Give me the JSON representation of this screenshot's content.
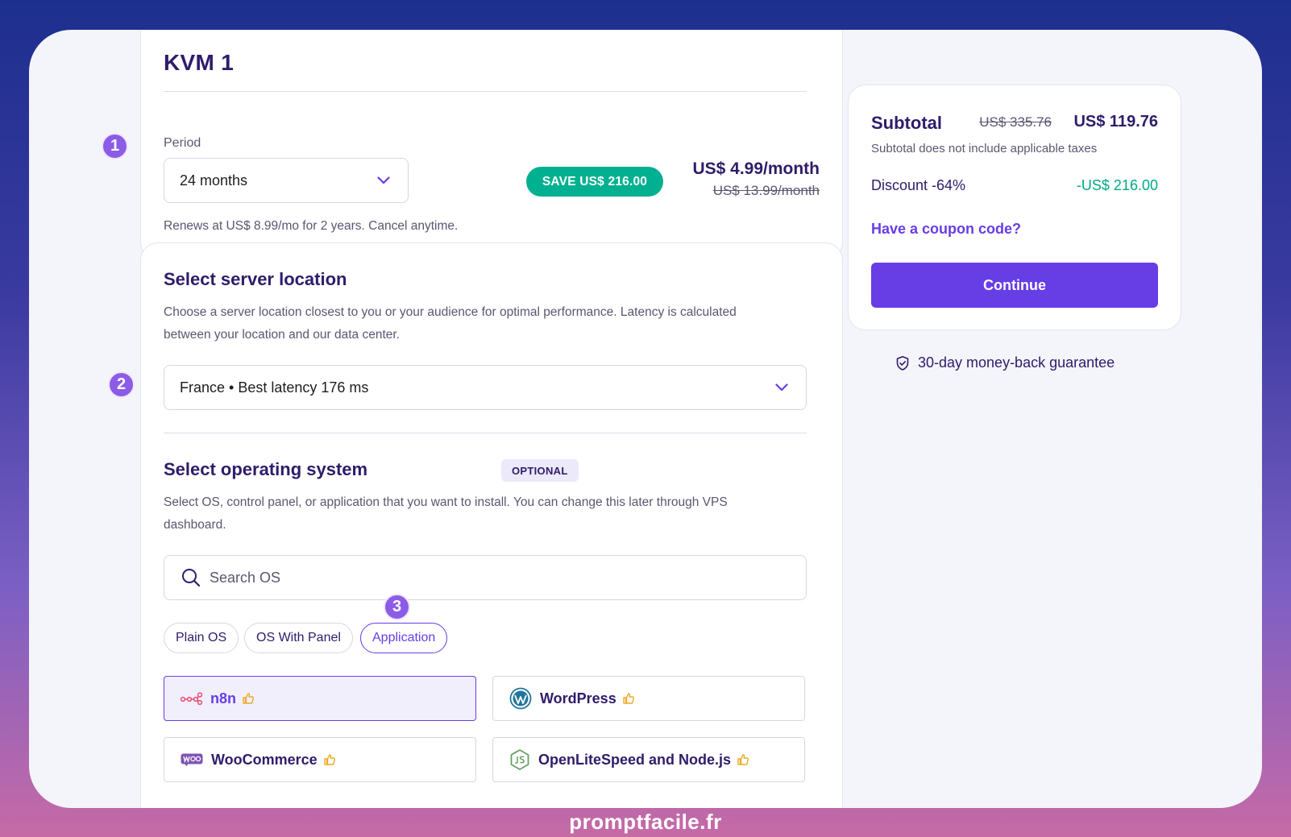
{
  "plan": {
    "title": "KVM 1",
    "period_label": "Period",
    "period_value": "24 months",
    "save_badge": "SAVE US$ 216.00",
    "price_now": "US$ 4.99/month",
    "price_old": "US$ 13.99/month",
    "renew_note": "Renews at US$ 8.99/mo for 2 years. Cancel anytime."
  },
  "steps": [
    "1",
    "2",
    "3"
  ],
  "location": {
    "heading": "Select server location",
    "description_line1": "Choose a server location closest to you or your audience for optimal performance. Latency is calculated",
    "description_line2": "between your location and our data center.",
    "selected": "France • Best latency 176 ms"
  },
  "os": {
    "heading": "Select operating system",
    "optional_badge": "OPTIONAL",
    "description_line1": "Select OS, control panel, or application that you want to install. You can change this later through VPS",
    "description_line2": "dashboard.",
    "search_placeholder": "Search OS",
    "filters": [
      "Plain OS",
      "OS With Panel",
      "Application"
    ],
    "active_filter": "Application",
    "apps": [
      "n8n",
      "WordPress",
      "WooCommerce",
      "OpenLiteSpeed and Node.js"
    ],
    "selected_app": "n8n"
  },
  "summary": {
    "title": "Subtotal",
    "old_price": "US$ 335.76",
    "new_price": "US$ 119.76",
    "note": "Subtotal does not include applicable taxes",
    "discount_label": "Discount -64%",
    "discount_value": "-US$ 216.00",
    "coupon_link": "Have a coupon code?",
    "continue_label": "Continue",
    "guarantee": "30-day money-back guarantee"
  },
  "watermark": "promptfacile.fr",
  "colors": {
    "primary": "#673de6",
    "success": "#00b090",
    "step_badge": "#8c5ce6",
    "text_dark": "#2f1c6a"
  }
}
